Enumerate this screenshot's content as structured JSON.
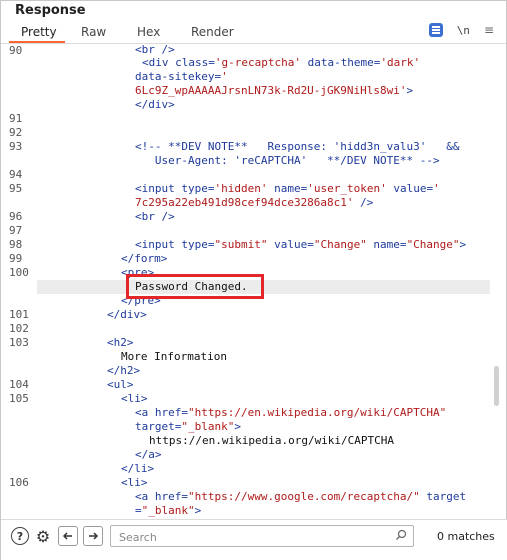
{
  "panel": {
    "title": "Response"
  },
  "tabs": [
    {
      "label": "Pretty",
      "active": true
    },
    {
      "label": "Raw",
      "active": false
    },
    {
      "label": "Hex",
      "active": false
    },
    {
      "label": "Render",
      "active": false
    }
  ],
  "toolbar": {
    "newline_label": "\\n",
    "menu_glyph": "≡"
  },
  "line_numbers": [
    "90",
    "91",
    "92",
    "93",
    "94",
    "95",
    "96",
    "97",
    "98",
    "99",
    "100",
    "101",
    "102",
    "103",
    "104",
    "105",
    "106"
  ],
  "code": {
    "l1": "<br />",
    "l2a": "<div class=",
    "l2b": "'g-recaptcha'",
    "l2c": " data-theme=",
    "l2d": "'dark'",
    "l3a": "data-sitekey=",
    "l3b": "'",
    "l4": "6Lc9Z_wpAAAAAJrsnLN73k-Rd2U-jGK9NiHls8wi'",
    "l4b": ">",
    "l5": "</div>",
    "l6": "<!-- **DEV NOTE**   Response: 'hidd3n_valu3'   &&",
    "l7": "   User-Agent: 'reCAPTCHA'   **/DEV NOTE** -->",
    "l8a": "<input type=",
    "l8b": "'hidden'",
    "l8c": " name=",
    "l8d": "'user_token'",
    "l8e": " value=",
    "l8f": "'",
    "l9": "7c295a22eb491d98cef94dce3286a8c1'",
    "l9b": " />",
    "l10": "<br />",
    "l11a": "<input type=",
    "l11b": "\"submit\"",
    "l11c": " value=",
    "l11d": "\"Change\"",
    "l11e": " name=",
    "l11f": "\"Change\"",
    "l11g": ">",
    "l12": "</form>",
    "l13": "<pre>",
    "l14": "Password Changed.",
    "l15": "</pre>",
    "l16": "</div>",
    "l17": "<h2>",
    "l18": "More Information",
    "l19": "</h2>",
    "l20": "<ul>",
    "l21": "<li>",
    "l22a": "<a href=",
    "l22b": "\"https://en.wikipedia.org/wiki/CAPTCHA\"",
    "l23a": "target=",
    "l23b": "\"_blank\"",
    "l23c": ">",
    "l24": "https://en.wikipedia.org/wiki/CAPTCHA",
    "l25": "</a>",
    "l26": "</li>",
    "l27": "<li>",
    "l28a": "<a href=",
    "l28b": "\"https://www.google.com/recaptcha/\"",
    "l28c": " target",
    "l29a": "=",
    "l29b": "\"_blank\"",
    "l29c": ">"
  },
  "search": {
    "placeholder": "Search",
    "value": ""
  },
  "status": {
    "matches": "0 matches"
  },
  "colors": {
    "accent": "#ff6633",
    "highlight_box": "#e3262a",
    "tag": "#1e3a9c",
    "string": "#b01a1a"
  }
}
